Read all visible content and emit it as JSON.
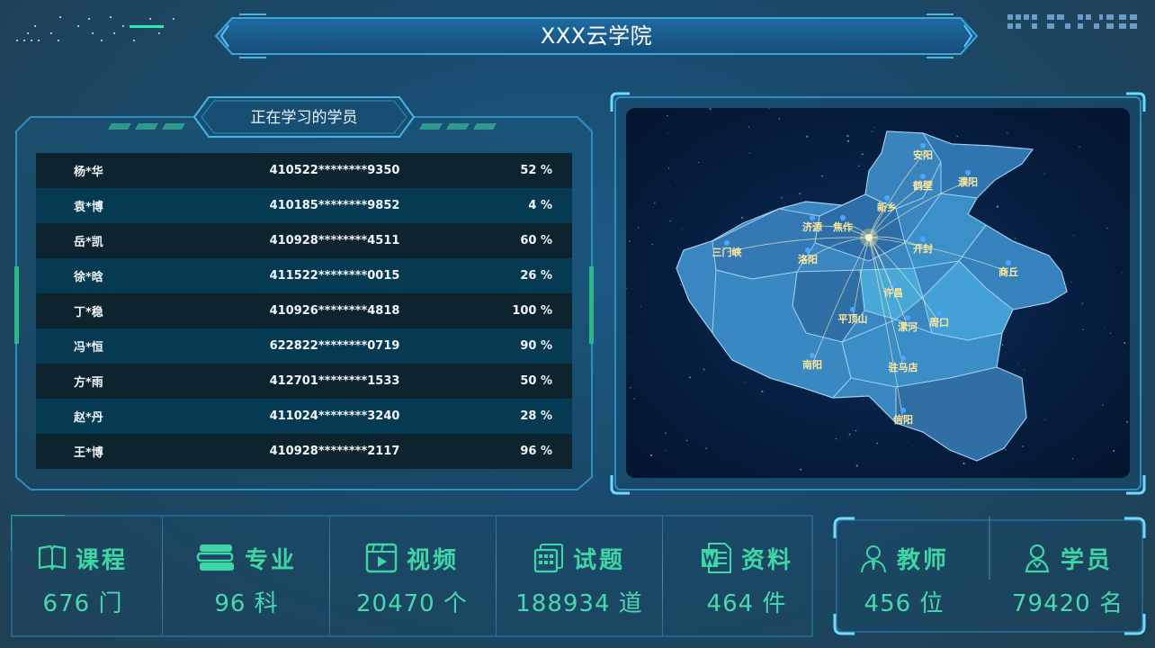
{
  "header": {
    "title": "XXX云学院"
  },
  "students_panel": {
    "title": "正在学习的学员",
    "rows": [
      {
        "name": "杨*华",
        "id": "410522********9350",
        "progress": "52 %"
      },
      {
        "name": "袁*博",
        "id": "410185********9852",
        "progress": "4 %"
      },
      {
        "name": "岳*凯",
        "id": "410928********4511",
        "progress": "60 %"
      },
      {
        "name": "徐*晗",
        "id": "411522********0015",
        "progress": "26 %"
      },
      {
        "name": "丁*稳",
        "id": "410926********4818",
        "progress": "100 %"
      },
      {
        "name": "冯*恒",
        "id": "622822********0719",
        "progress": "90 %"
      },
      {
        "name": "方*雨",
        "id": "412701********1533",
        "progress": "50 %"
      },
      {
        "name": "赵*丹",
        "id": "411024********3240",
        "progress": "28 %"
      },
      {
        "name": "王*博",
        "id": "410928********2117",
        "progress": "96 %"
      }
    ]
  },
  "map": {
    "cities": [
      "安阳",
      "鹤壁",
      "濮阳",
      "新乡",
      "济源",
      "焦作",
      "三门峡",
      "洛阳",
      "开封",
      "商丘",
      "许昌",
      "平顶山",
      "漯河",
      "周口",
      "南阳",
      "驻马店",
      "信阳"
    ]
  },
  "stats": [
    {
      "label": "课程",
      "value": "676 门",
      "icon": "open-book-icon"
    },
    {
      "label": "专业",
      "value": "96 科",
      "icon": "book-stack-icon"
    },
    {
      "label": "视频",
      "value": "20470 个",
      "icon": "video-play-icon"
    },
    {
      "label": "试题",
      "value": "188934 道",
      "icon": "test-papers-icon"
    },
    {
      "label": "资料",
      "value": "464 件",
      "icon": "word-document-icon"
    }
  ],
  "people_stats": [
    {
      "label": "教师",
      "value": "456 位",
      "icon": "teacher-icon"
    },
    {
      "label": "学员",
      "value": "79420 名",
      "icon": "student-icon"
    }
  ],
  "colors": {
    "accent": "#3fd6a6",
    "panel_border": "#2b8fc0",
    "row_dark": "#0d242e",
    "row_blue": "#053a52"
  }
}
